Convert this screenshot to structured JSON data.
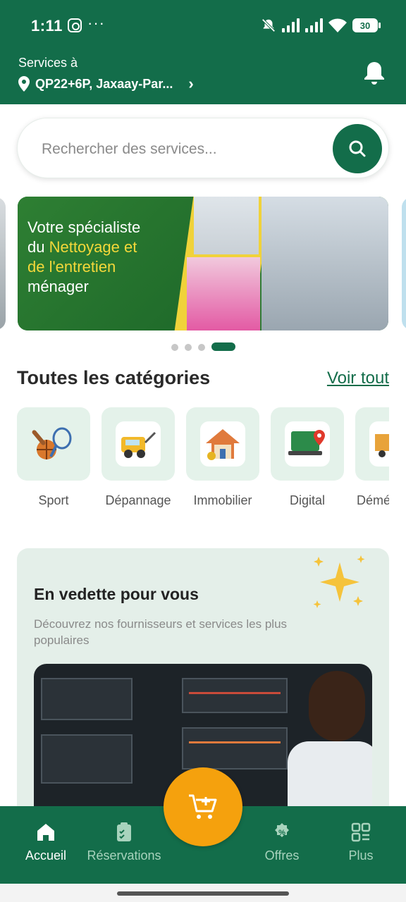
{
  "status_bar": {
    "time": "1:11",
    "more": "···",
    "battery": "30"
  },
  "header": {
    "services_label": "Services à",
    "location": "QP22+6P, Jaxaay-Par...",
    "chevron": "›"
  },
  "search": {
    "placeholder": "Rechercher des services..."
  },
  "banner": {
    "line1": "Votre spécialiste",
    "line2_a": "du ",
    "line2_b": "Nettoyage et",
    "line3": "de l'entretien",
    "line4": "ménager",
    "page_count": 4,
    "active_page": 4
  },
  "categories": {
    "title": "Toutes les catégories",
    "see_all": "Voir tout",
    "items": [
      {
        "label": "Sport",
        "icon": "sport-icon"
      },
      {
        "label": "Dépannage",
        "icon": "tow-truck-icon"
      },
      {
        "label": "Immobilier",
        "icon": "house-icon"
      },
      {
        "label": "Digital",
        "icon": "laptop-map-icon"
      },
      {
        "label": "Démé",
        "icon": "moving-truck-icon"
      }
    ]
  },
  "featured": {
    "title": "En vedette pour vous",
    "subtitle": "Découvrez nos fournisseurs et services les plus populaires"
  },
  "nav": {
    "items": [
      {
        "label": "Accueil",
        "icon": "home-icon",
        "active": true
      },
      {
        "label": "Réservations",
        "icon": "clipboard-icon",
        "active": false
      },
      {
        "label": "Offres",
        "icon": "discount-badge-icon",
        "active": false
      },
      {
        "label": "Plus",
        "icon": "grid-icon",
        "active": false
      }
    ],
    "fab_icon": "cart-add-icon"
  },
  "colors": {
    "brand_green": "#136d4a",
    "accent_orange": "#f5a10d",
    "category_bg": "#e4f2ea"
  }
}
